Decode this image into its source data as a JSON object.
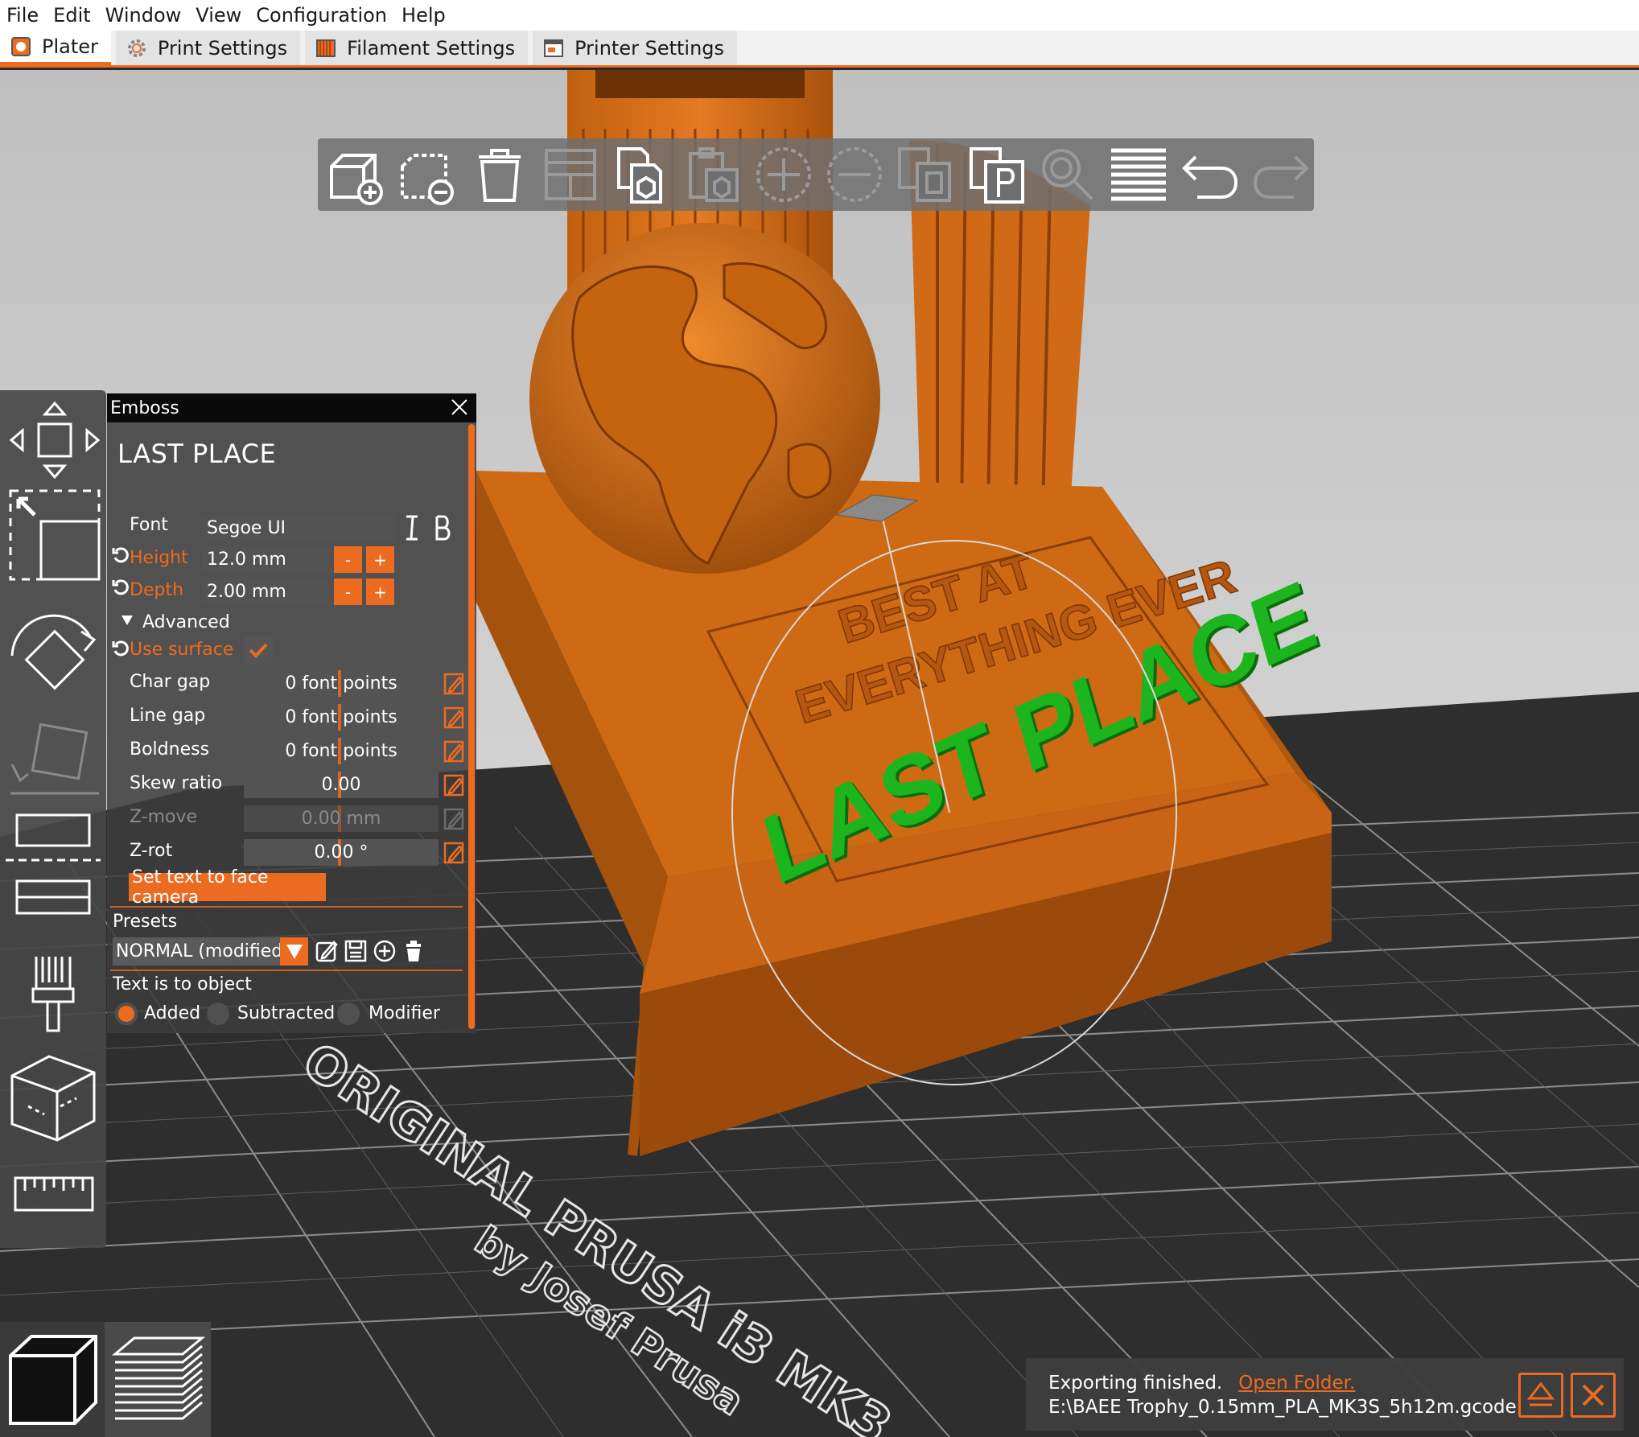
{
  "menu": [
    "File",
    "Edit",
    "Window",
    "View",
    "Configuration",
    "Help"
  ],
  "tabs": [
    {
      "label": "Plater",
      "icon": "plater-icon",
      "active": true
    },
    {
      "label": "Print Settings",
      "icon": "gear-icon",
      "active": false
    },
    {
      "label": "Filament Settings",
      "icon": "filament-spool-icon",
      "active": false
    },
    {
      "label": "Printer Settings",
      "icon": "printer-icon",
      "active": false
    }
  ],
  "toolbar": [
    {
      "name": "add-button",
      "icon": "add-object-icon",
      "enabled": true
    },
    {
      "name": "delete-button",
      "icon": "delete-object-icon",
      "enabled": true
    },
    {
      "name": "delete-all-button",
      "icon": "trash-icon",
      "enabled": true
    },
    {
      "name": "arrange-button",
      "icon": "arrange-icon",
      "enabled": false
    },
    {
      "name": "copy-button",
      "icon": "copy-icon",
      "enabled": true
    },
    {
      "name": "paste-button",
      "icon": "paste-icon",
      "enabled": false
    },
    {
      "name": "add-instance-button",
      "icon": "plus-circle-icon",
      "enabled": false
    },
    {
      "name": "remove-instance-button",
      "icon": "minus-circle-icon",
      "enabled": false
    },
    {
      "name": "split-objects-button",
      "icon": "split-objects-icon",
      "enabled": false
    },
    {
      "name": "split-parts-button",
      "icon": "split-parts-icon",
      "enabled": true
    },
    {
      "name": "search-button",
      "icon": "search-icon",
      "enabled": false
    },
    {
      "name": "layers-editing-button",
      "icon": "layers-icon",
      "enabled": true
    },
    {
      "name": "undo-button",
      "icon": "undo-icon",
      "enabled": true
    },
    {
      "name": "redo-button",
      "icon": "redo-icon",
      "enabled": false
    }
  ],
  "emboss": {
    "title": "Emboss",
    "text": "LAST PLACE",
    "font_label": "Font",
    "font_value": "Segoe UI",
    "height_label": "Height",
    "height_value": "12.0 mm",
    "depth_label": "Depth",
    "depth_value": "2.00 mm",
    "minus": "-",
    "plus": "+",
    "advanced_label": "Advanced",
    "use_surface_label": "Use surface",
    "use_surface_checked": true,
    "char_gap_label": "Char gap",
    "char_gap_value": "0 font points",
    "line_gap_label": "Line gap",
    "line_gap_value": "0 font points",
    "boldness_label": "Boldness",
    "boldness_value": "0 font points",
    "skew_label": "Skew ratio",
    "skew_value": "0.00",
    "zmove_label": "Z-move",
    "zmove_value": "0.00 mm",
    "zrot_label": "Z-rot",
    "zrot_value": "0.00 °",
    "face_camera_label": "Set text to face camera",
    "presets_label": "Presets",
    "preset_value": "NORMAL (modified)",
    "text_to_object_label": "Text is to object",
    "mode_added": "Added",
    "mode_subtracted": "Subtracted",
    "mode_modifier": "Modifier",
    "mode_selected": "Added"
  },
  "bed": {
    "line1": "ORIGINAL PRUSA i3 MK3",
    "line2": "by Josef Prusa"
  },
  "model": {
    "engraved_line1": "BEST AT",
    "engraved_line2": "EVERYTHING EVER",
    "embossed_text": "LAST PLACE",
    "color": "#c96a17",
    "text_color": "#1aa51a"
  },
  "notification": {
    "message": "Exporting finished.",
    "link": "Open Folder.",
    "path": "E:\\BAEE Trophy_0.15mm_PLA_MK3S_5h12m.gcode"
  },
  "colors": {
    "accent": "#ed6b21",
    "background_top": "#e0e0e0",
    "bed": "#2d2d2d"
  }
}
